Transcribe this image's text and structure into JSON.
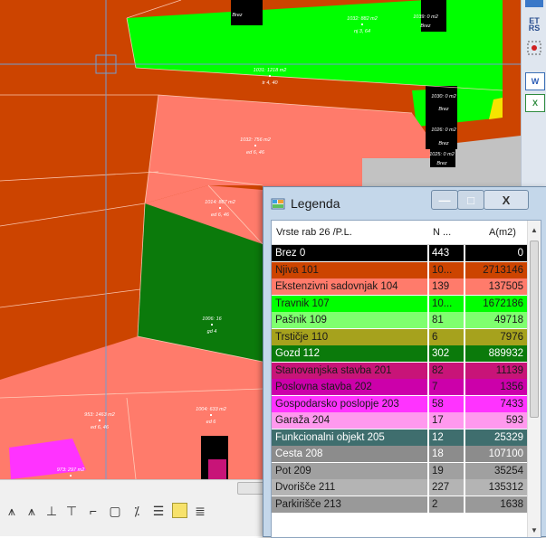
{
  "map": {
    "parcel_labels": [
      {
        "area": "1032: 882 m2",
        "code": "nj 3, 64"
      },
      {
        "area": "1031: 1218 m2",
        "code": "tr 4, 40"
      },
      {
        "area": "1032: 756 m2",
        "code": "ed 6, 46"
      },
      {
        "area": "1014: 887 m2",
        "code": "ed 6, 46"
      },
      {
        "area": "1006: 16",
        "code": "gd 4"
      },
      {
        "area": "953: 1463 m2",
        "code": "ed 6, 46"
      },
      {
        "area": "1004: 633 m2",
        "code": "ed 6"
      },
      {
        "area": "973: 297 m2",
        "code": ""
      }
    ],
    "building_labels": [
      "1039: 0 m2",
      "Brez",
      "Brez",
      "1030: 0 m2",
      "Brez",
      "1026: 0 m2",
      "Brez",
      "1025: 0 m2",
      "Brez"
    ]
  },
  "right_toolbar": {
    "et_label": "ET",
    "rs_label": "RS",
    "word_label": "W",
    "excel_label": "X"
  },
  "colors": {
    "brez": "#000000",
    "njiva": "#cc4400",
    "sadovnjak": "#ff7b6b",
    "travnik": "#00ff00",
    "pasnik": "#7fff6f",
    "trstje": "#a6a21d",
    "gozd": "#0b7a0b",
    "stanovanjska": "#c81478",
    "poslovna": "#cc00aa",
    "gospodarsko": "#ff33ff",
    "garaza": "#ff99ee",
    "funkcionalni": "#3f6e6e",
    "cesta": "#8c8c8c",
    "pot": "#a0a0a0",
    "dvorisce": "#b4b4b4",
    "parkirisce": "#999999",
    "window_accent": "#4a7fc1"
  },
  "legend": {
    "title": "Legenda",
    "minimize": "—",
    "maximize": "□",
    "close": "X",
    "columns": {
      "name": "Vrste rab 26 /P.L.",
      "n": "N ...",
      "area": "A(m2)"
    },
    "rows": [
      {
        "name": "Brez  0",
        "n": "443",
        "area": "0",
        "bg": "#000000",
        "fg": "#ffffff"
      },
      {
        "name": "Njiva  101",
        "n": "10...",
        "area": "2713146",
        "bg": "#cc4400",
        "fg": "#1a1a1a"
      },
      {
        "name": "Ekstenzivni sadovnjak  104",
        "n": "139",
        "area": "137505",
        "bg": "#ff7b6b",
        "fg": "#1a1a1a"
      },
      {
        "name": "Travnik  107",
        "n": "10...",
        "area": "1672186",
        "bg": "#00ff00",
        "fg": "#1a1a1a"
      },
      {
        "name": "Pašnik  109",
        "n": "81",
        "area": "49718",
        "bg": "#7fff6f",
        "fg": "#1a1a1a"
      },
      {
        "name": "Trstičje  110",
        "n": "6",
        "area": "7976",
        "bg": "#a6a21d",
        "fg": "#1a1a1a"
      },
      {
        "name": "Gozd  112",
        "n": "302",
        "area": "889932",
        "bg": "#0b7a0b",
        "fg": "#ffffff"
      },
      {
        "name": "Stanovanjska stavba  201",
        "n": "82",
        "area": "11139",
        "bg": "#c81478",
        "fg": "#1a1a1a"
      },
      {
        "name": "Poslovna stavba  202",
        "n": "7",
        "area": "1356",
        "bg": "#cc00aa",
        "fg": "#1a1a1a"
      },
      {
        "name": "Gospodarsko poslopje  203",
        "n": "58",
        "area": "7433",
        "bg": "#ff33ff",
        "fg": "#1a1a1a"
      },
      {
        "name": "Garaža  204",
        "n": "17",
        "area": "593",
        "bg": "#ff99ee",
        "fg": "#1a1a1a"
      },
      {
        "name": "Funkcionalni objekt  205",
        "n": "12",
        "area": "25329",
        "bg": "#3f6e6e",
        "fg": "#ffffff"
      },
      {
        "name": "Cesta  208",
        "n": "18",
        "area": "107100",
        "bg": "#8c8c8c",
        "fg": "#ffffff"
      },
      {
        "name": "Pot  209",
        "n": "19",
        "area": "35254",
        "bg": "#a0a0a0",
        "fg": "#1a1a1a"
      },
      {
        "name": "Dvorišče  211",
        "n": "227",
        "area": "135312",
        "bg": "#b4b4b4",
        "fg": "#1a1a1a"
      },
      {
        "name": "Parkirišče  213",
        "n": "2",
        "area": "1638",
        "bg": "#999999",
        "fg": "#1a1a1a"
      }
    ]
  }
}
